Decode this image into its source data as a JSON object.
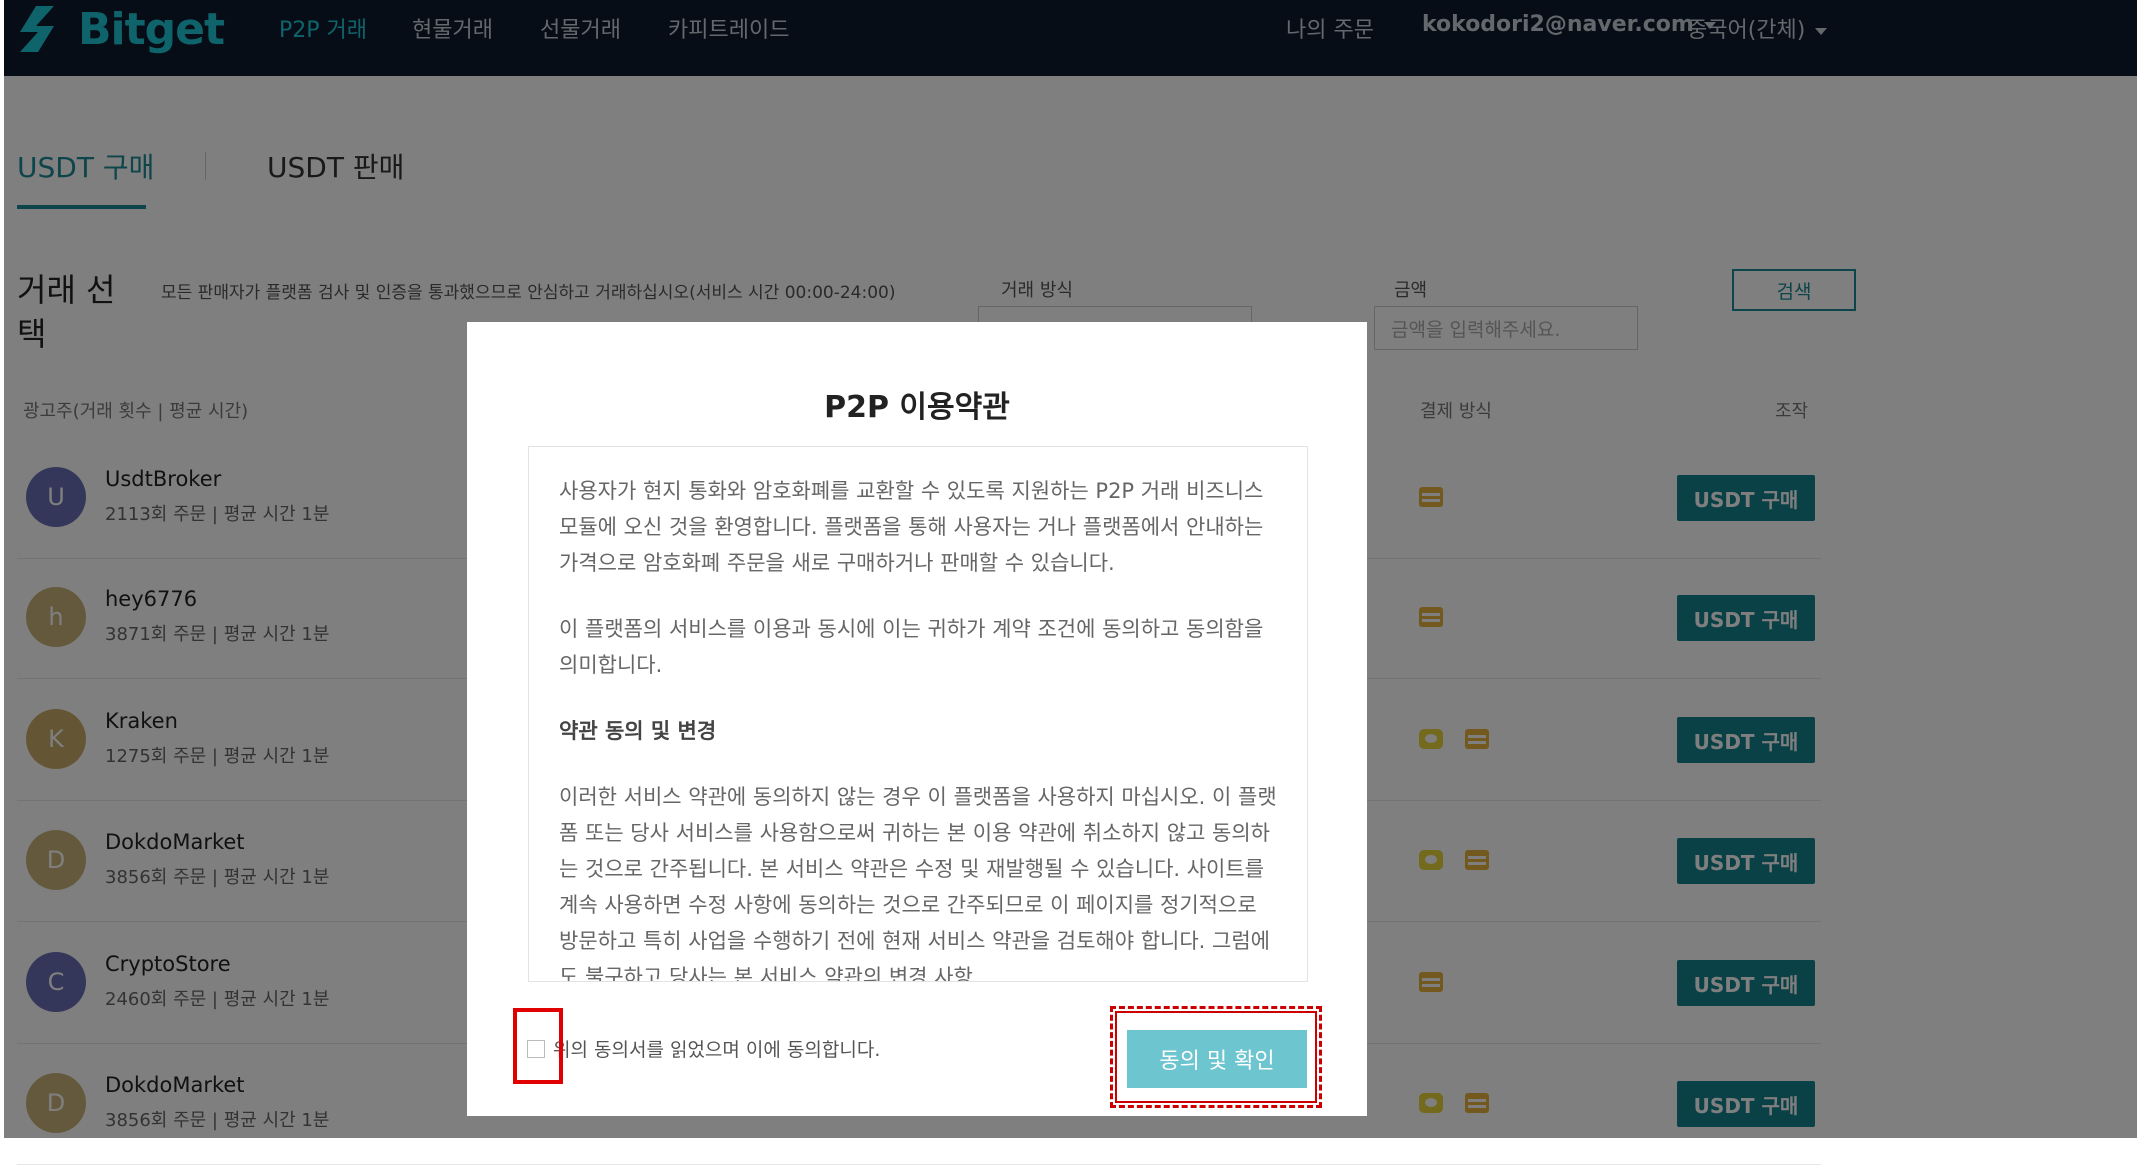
{
  "brand": {
    "logo_text": "Bitget",
    "accent": "#1ec8d6",
    "nav_bg": "#0e1b2e"
  },
  "nav": {
    "links": [
      "P2P 거래",
      "현물거래",
      "선물거래",
      "카피트레이드"
    ],
    "my_orders": "나의 주문",
    "account": "kokodori2@naver.com",
    "language": "중국어(간체)"
  },
  "tabs": {
    "buy": "USDT 구매",
    "sell": "USDT 판매"
  },
  "filters": {
    "title": "거래 선택",
    "notice": "모든 판매자가 플랫폼 검사 및 인증을 통과했으므로 안심하고 거래하십시오(서비스 시간 00:00-24:00)",
    "trade_method_label": "거래 방식",
    "amount_label": "금액",
    "amount_placeholder": "금액을 입력해주세요.",
    "search_label": "검색"
  },
  "columns": {
    "advertiser": "광고주(거래 횟수 | 평균 시간)",
    "payment": "결제 방식",
    "action": "조작"
  },
  "advertisers": [
    {
      "initial": "U",
      "name": "UsdtBroker",
      "stats": "2113회 주문 | 평균 시간 1분",
      "color": "#6a6fb5",
      "payments": [
        "card-icon"
      ],
      "button": "USDT 구매"
    },
    {
      "initial": "h",
      "name": "hey6776",
      "stats": "3871회 주문 | 평균 시간 1분",
      "color": "#c9b27a",
      "payments": [
        "card-icon"
      ],
      "button": "USDT 구매"
    },
    {
      "initial": "K",
      "name": "Kraken",
      "stats": "1275회 주문 | 평균 시간 1분",
      "color": "#c9ad6a",
      "payments": [
        "chat-icon",
        "card-icon"
      ],
      "button": "USDT 구매"
    },
    {
      "initial": "D",
      "name": "DokdoMarket",
      "stats": "3856회 주문 | 평균 시간 1분",
      "color": "#c9b27a",
      "payments": [
        "chat-icon",
        "card-icon"
      ],
      "button": "USDT 구매"
    },
    {
      "initial": "C",
      "name": "CryptoStore",
      "stats": "2460회 주문 | 평균 시간 1분",
      "color": "#6a6fb5",
      "payments": [
        "card-icon"
      ],
      "button": "USDT 구매"
    },
    {
      "initial": "D",
      "name": "DokdoMarket",
      "stats": "3856회 주문 | 평균 시간 1분",
      "color": "#c9b27a",
      "payments": [
        "chat-icon",
        "card-icon"
      ],
      "button": "USDT 구매"
    }
  ],
  "modal": {
    "title": "P2P 이용약관",
    "paragraphs": [
      "사용자가 현지 통화와 암호화폐를 교환할 수 있도록 지원하는 P2P 거래 비즈니스 모듈에 오신 것을 환영합니다. 플랫폼을 통해 사용자는 거나 플랫폼에서 안내하는 가격으로 암호화폐 주문을 새로 구매하거나 판매할 수 있습니다.",
      "이 플랫폼의 서비스를 이용과 동시에 이는 귀하가 계약 조건에 동의하고 동의함을 의미합니다.",
      "약관 동의 및 변경",
      "이러한 서비스 약관에 동의하지 않는 경우 이 플랫폼을 사용하지 마십시오. 이 플랫폼 또는 당사 서비스를 사용함으로써 귀하는 본 이용 약관에 취소하지 않고 동의하는 것으로 간주됩니다. 본 서비스 약관은 수정 및 재발행될 수 있습니다. 사이트를 계속 사용하면 수정 사항에 동의하는 것으로 간주되므로 이 페이지를 정기적으로 방문하고 특히 사업을 수행하기 전에 현재 서비스 약관을 검토해야 합니다. 그럼에도 불구하고 당사는 본 서비스 약관의 변경 사항"
    ],
    "agree_text": "위의 동의서를 읽었으며 이에 동의합니다.",
    "confirm_label": "동의 및 확인",
    "confirm_color": "#6cc5cf"
  }
}
